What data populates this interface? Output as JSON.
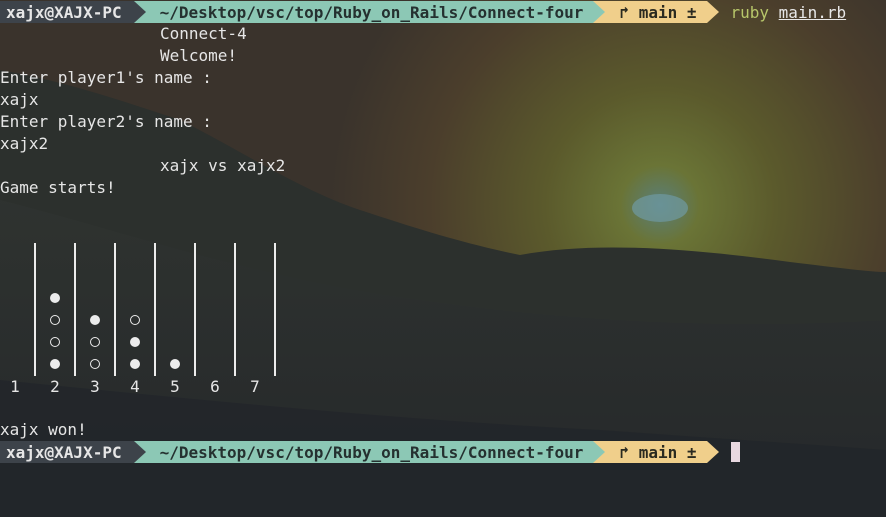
{
  "prompt": {
    "user": "xajx@XAJX-PC",
    "path": "~/Desktop/vsc/top/Ruby_on_Rails/Connect-four",
    "git_branch": "main ±",
    "command_prog": "ruby",
    "command_arg": "main.rb"
  },
  "output": {
    "title": "Connect-4",
    "welcome": "Welcome!",
    "p1_prompt": "Enter player1's name :",
    "p1_name": "xajx",
    "p2_prompt": "Enter player2's name :",
    "p2_name": "xajx2",
    "versus": "xajx vs xajx2",
    "game_starts": "Game starts!",
    "result": "xajx won!"
  },
  "board": {
    "column_numbers": [
      "1",
      "2",
      "3",
      "4",
      "5",
      "6",
      "7"
    ],
    "columns": [
      [],
      [
        "filled",
        "empty",
        "empty",
        "filled"
      ],
      [
        "empty",
        "empty",
        "filled"
      ],
      [
        "filled",
        "filled",
        "empty"
      ],
      [
        "filled"
      ],
      [],
      []
    ]
  },
  "colors": {
    "user_bg": "#3d434a",
    "path_bg": "#8cc8b5",
    "git_bg": "#f0cf8b",
    "ruby_text": "#b7c66a"
  }
}
